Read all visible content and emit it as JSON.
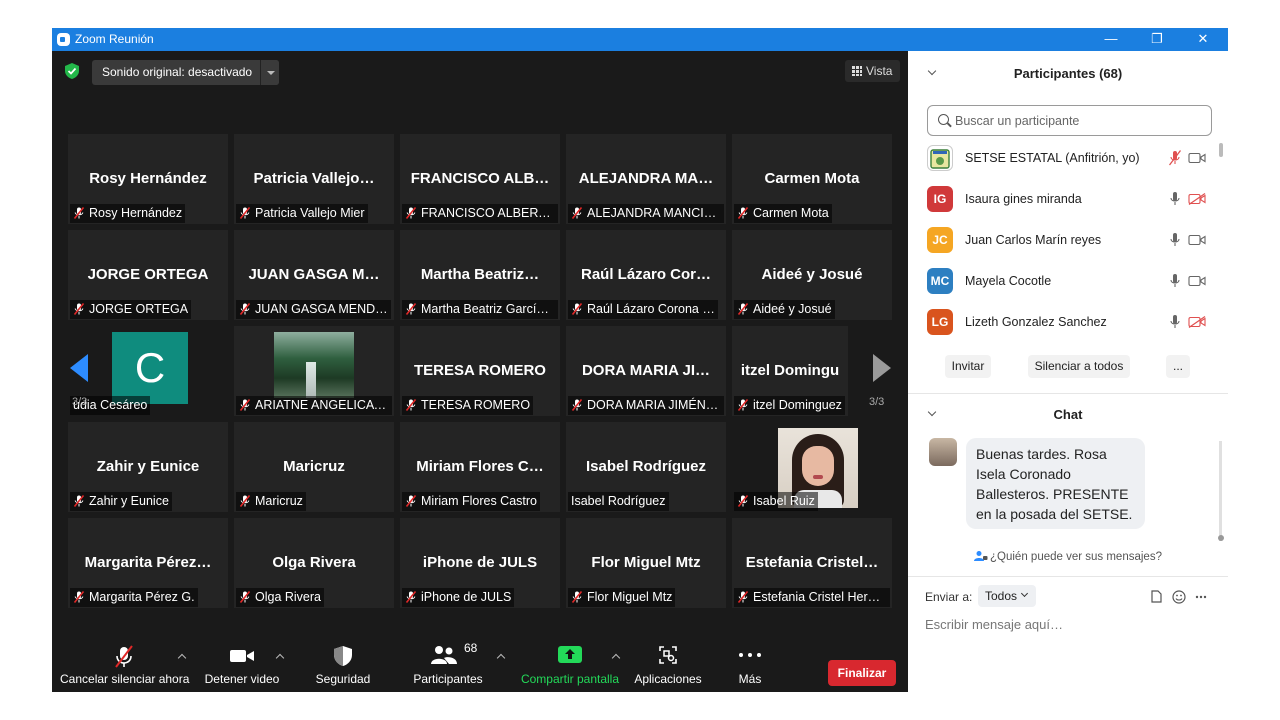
{
  "window": {
    "title": "Zoom Reunión",
    "minimize": "—",
    "restore": "❐",
    "close": "✕"
  },
  "top": {
    "sonido": "Sonido original: desactivado",
    "vista": "Vista"
  },
  "grid": {
    "rows": [
      [
        {
          "big": "Rosy Hernández",
          "label": "Rosy Hernández"
        },
        {
          "big": "Patricia  Vallejo…",
          "label": "Patricia Vallejo Mier"
        },
        {
          "big": "FRANCISCO ALB…",
          "label": "FRANCISCO ALBERTO…"
        },
        {
          "big": "ALEJANDRA MA…",
          "label": "ALEJANDRA MANCILLA"
        },
        {
          "big": "Carmen Mota",
          "label": "Carmen Mota"
        }
      ],
      [
        {
          "big": "JORGE ORTEGA",
          "label": "JORGE ORTEGA"
        },
        {
          "big": "JUAN GASGA M…",
          "label": "JUAN GASGA MEND…"
        },
        {
          "big": "Martha  Beatriz…",
          "label": "Martha Beatriz García…"
        },
        {
          "big": "Raúl  Lázaro  Cor…",
          "label": "Raúl Lázaro Corona …"
        },
        {
          "big": "Aideé y Josué",
          "label": "Aideé y Josué"
        }
      ],
      [
        {
          "big": "",
          "label": "udia Cesáreo",
          "avatar_letter": "C"
        },
        {
          "big": "",
          "label": "ARIATNE ANGELICA R…"
        },
        {
          "big": "TERESA ROMERO",
          "label": "TERESA ROMERO"
        },
        {
          "big": "DORA MARIA JI…",
          "label": "DORA MARIA JIMÉNE…"
        },
        {
          "big": "itzel Domingu",
          "label": "itzel Dominguez"
        }
      ],
      [
        {
          "big": "Zahir y Eunice",
          "label": "Zahir y Eunice"
        },
        {
          "big": "Maricruz",
          "label": "Maricruz"
        },
        {
          "big": "Miriam  Flores  C…",
          "label": "Miriam Flores Castro"
        },
        {
          "big": "Isabel Rodríguez",
          "label": "Isabel Rodríguez"
        },
        {
          "big": "",
          "label": "Isabel Ruiz"
        }
      ],
      [
        {
          "big": "Margarita  Pérez…",
          "label": "Margarita Pérez G."
        },
        {
          "big": "Olga Rivera",
          "label": "Olga Rivera"
        },
        {
          "big": "iPhone de JULS",
          "label": "iPhone de JULS"
        },
        {
          "big": "Flor Miguel Mtz",
          "label": "Flor Miguel Mtz"
        },
        {
          "big": "Estefania  Cristel…",
          "label": "Estefania Cristel Hern…"
        }
      ]
    ],
    "page_left": "3/3",
    "page_right": "3/3"
  },
  "toolbar": {
    "unmute": "Cancelar silenciar ahora",
    "video": "Detener video",
    "security": "Seguridad",
    "participants": "Participantes",
    "participants_count": "68",
    "share": "Compartir pantalla",
    "apps": "Aplicaciones",
    "more": "Más",
    "end": "Finalizar"
  },
  "participants": {
    "title": "Participantes (68)",
    "search_placeholder": "Buscar un participante",
    "list": [
      {
        "initials": "",
        "name": "SETSE ESTATAL (Anfitrión, yo)",
        "color": "#ffffff"
      },
      {
        "initials": "IG",
        "name": "Isaura gines miranda",
        "color": "#d0393a"
      },
      {
        "initials": "JC",
        "name": "Juan Carlos Marín reyes",
        "color": "#f5a623"
      },
      {
        "initials": "MC",
        "name": "Mayela Cocotle",
        "color": "#2d7fc1"
      },
      {
        "initials": "LG",
        "name": "Lizeth Gonzalez Sanchez",
        "color": "#d9541e"
      }
    ],
    "invite": "Invitar",
    "mute_all": "Silenciar a todos",
    "more": "..."
  },
  "chat": {
    "title": "Chat",
    "message": "Buenas tardes. Rosa Isela Coronado Ballesteros. PRESENTE en la posada del SETSE.",
    "who_can_see": "¿Quién puede ver sus mensajes?",
    "send_to_label": "Enviar a:",
    "send_to_value": "Todos",
    "input_placeholder": "Escribir mensaje aquí…"
  },
  "colors": {
    "titlebar": "#1b7fe0",
    "accent": "#2d8cff",
    "end_button": "#d8282f",
    "share_green": "#23d959",
    "muted_red": "#e02828"
  }
}
